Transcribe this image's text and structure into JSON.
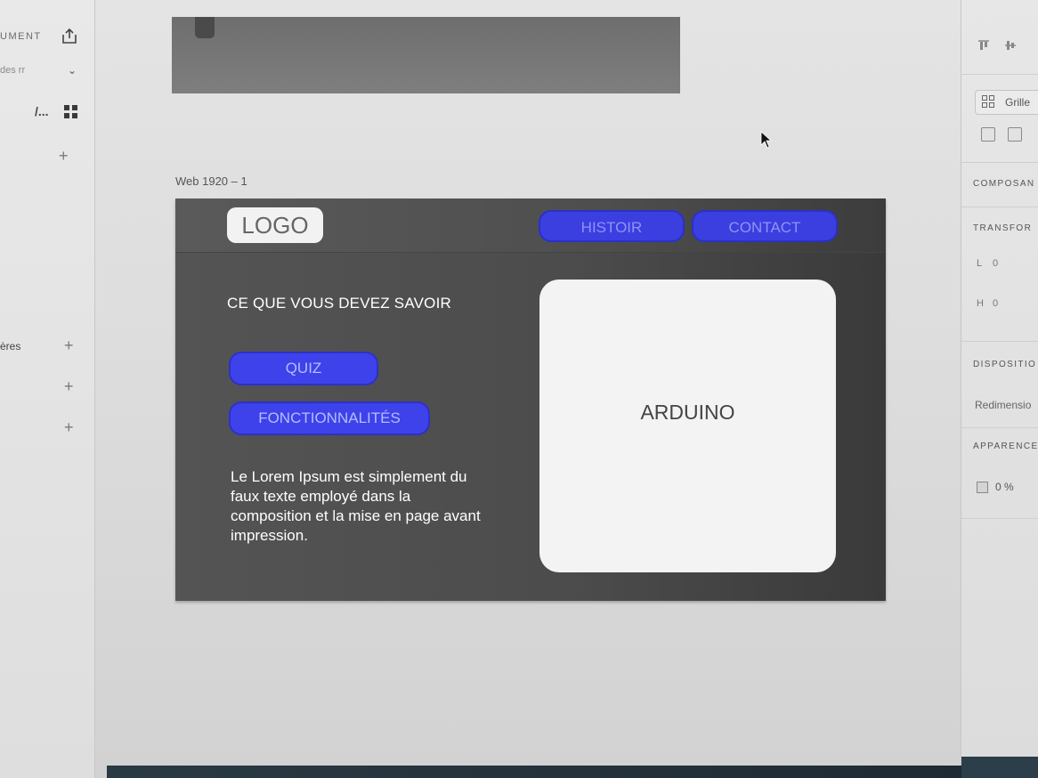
{
  "left_panel": {
    "doc_label": "UMENT",
    "dropdown_label": "des rr",
    "ellipsis_label": "/...",
    "layers_label": "ères",
    "plus_glyph": "+"
  },
  "canvas": {
    "artboard_label": "Web 1920 – 1"
  },
  "artboard": {
    "logo": "LOGO",
    "nav": [
      "HISTOIR",
      "CONTACT"
    ],
    "section_title": "CE QUE VOUS DEVEZ SAVOIR",
    "buttons": [
      "QUIZ",
      "FONCTIONNALITÉS"
    ],
    "body_text": "Le Lorem Ipsum est simplement du faux texte employé dans la composition et la mise en page avant impression.",
    "card_label": "ARDUINO"
  },
  "right_panel": {
    "grid_button": "Grille",
    "sections": [
      "COMPOSAN",
      "TRANSFOR",
      "DISPOSITIO",
      "Redimensio",
      "APPARENCE"
    ],
    "width_label": "L",
    "width_value": "0",
    "height_label": "H",
    "height_value": "0",
    "opacity_value": "0 %"
  },
  "colors": {
    "accent_blue": "#3b3fe0",
    "artboard_bg": "#4c4c4c",
    "card_bg": "#f3f3f3"
  }
}
